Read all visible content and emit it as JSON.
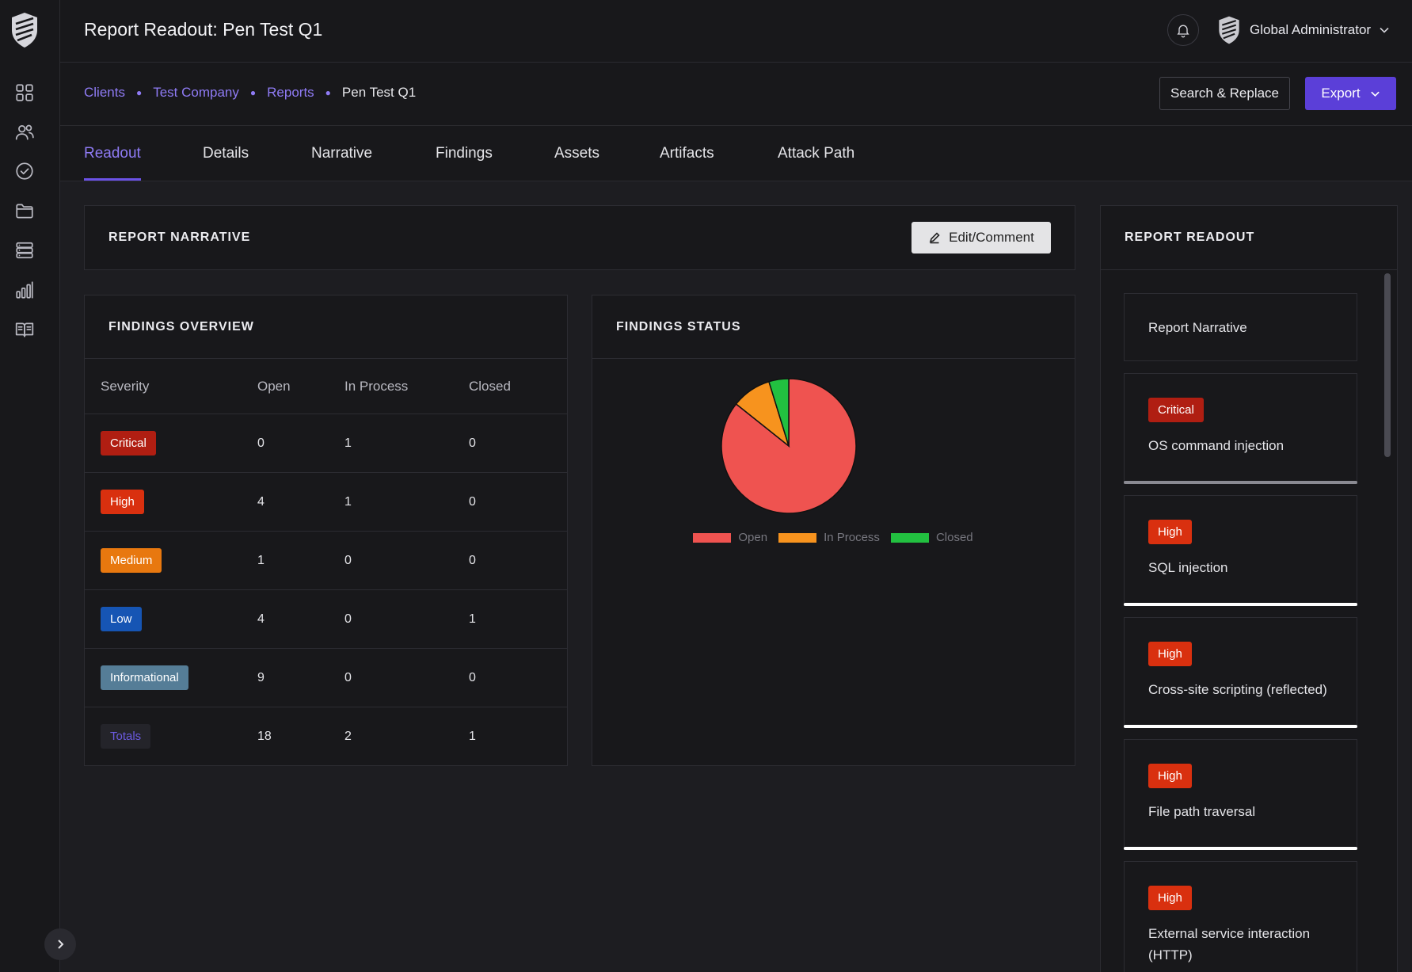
{
  "app": {
    "page_title": "Report Readout: Pen Test Q1",
    "user_name": "Global Administrator"
  },
  "nav_icons": [
    "dashboard-icon",
    "users-icon",
    "check-circle-icon",
    "folder-icon",
    "database-icon",
    "bar-chart-icon",
    "book-icon"
  ],
  "breadcrumb": {
    "items": [
      "Clients",
      "Test Company",
      "Reports"
    ],
    "current": "Pen Test Q1"
  },
  "actions": {
    "search_replace": "Search & Replace",
    "export": "Export",
    "edit_comment": "Edit/Comment"
  },
  "tabs": [
    "Readout",
    "Details",
    "Narrative",
    "Findings",
    "Assets",
    "Artifacts",
    "Attack Path"
  ],
  "active_tab": "Readout",
  "narrative": {
    "heading": "REPORT NARRATIVE"
  },
  "overview": {
    "heading": "FINDINGS OVERVIEW",
    "columns": [
      "Severity",
      "Open",
      "In Process",
      "Closed"
    ],
    "rows": [
      {
        "severity": "Critical",
        "open": "0",
        "in_process": "1",
        "closed": "0",
        "color": "#b01e12"
      },
      {
        "severity": "High",
        "open": "4",
        "in_process": "1",
        "closed": "0",
        "color": "#d9300f"
      },
      {
        "severity": "Medium",
        "open": "1",
        "in_process": "0",
        "closed": "0",
        "color": "#e8780f"
      },
      {
        "severity": "Low",
        "open": "4",
        "in_process": "0",
        "closed": "1",
        "color": "#1655b4"
      },
      {
        "severity": "Informational",
        "open": "9",
        "in_process": "0",
        "closed": "0",
        "color": "#557d97"
      }
    ],
    "totals": {
      "label": "Totals",
      "open": "18",
      "in_process": "2",
      "closed": "1"
    }
  },
  "status": {
    "heading": "FINDINGS STATUS",
    "chart_data": {
      "type": "pie",
      "categories": [
        "Open",
        "In Process",
        "Closed"
      ],
      "values": [
        18,
        2,
        1
      ],
      "colors": [
        "#ef5350",
        "#f7931e",
        "#22c040"
      ],
      "legend": "bottom"
    }
  },
  "readout": {
    "heading": "REPORT READOUT",
    "narrative_item": "Report Narrative",
    "items": [
      {
        "severity": "Critical",
        "title": "OS command injection",
        "color": "#b01e12",
        "bar": "#8a8a92"
      },
      {
        "severity": "High",
        "title": "SQL injection",
        "color": "#d9300f",
        "bar": "#ffffff"
      },
      {
        "severity": "High",
        "title": "Cross-site scripting (reflected)",
        "color": "#d9300f",
        "bar": "#ffffff"
      },
      {
        "severity": "High",
        "title": "File path traversal",
        "color": "#d9300f",
        "bar": "#ffffff"
      },
      {
        "severity": "High",
        "title": "External service interaction (HTTP)",
        "color": "#d9300f",
        "bar": "#ffffff"
      }
    ]
  },
  "colors": {
    "accent": "#6b52e6",
    "link": "#8f7bf5",
    "background": "#1d1d21",
    "panel": "#18181b"
  }
}
